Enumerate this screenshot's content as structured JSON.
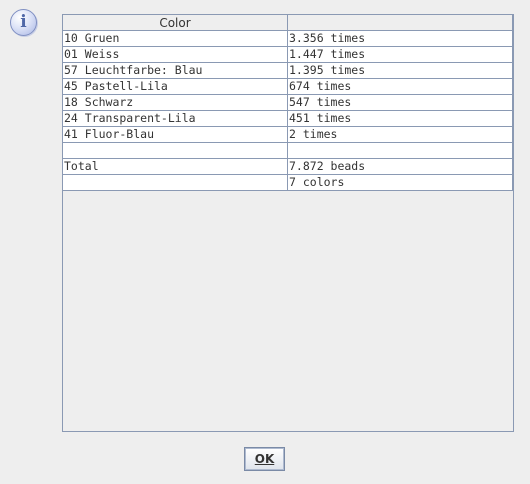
{
  "dialog": {
    "icon": "info-icon",
    "icon_glyph": "i",
    "table": {
      "columns": [
        "Color",
        ""
      ],
      "rows": [
        [
          "10 Gruen",
          "3.356 times"
        ],
        [
          "01 Weiss",
          "1.447 times"
        ],
        [
          "57 Leuchtfarbe: Blau",
          "1.395 times"
        ],
        [
          "45 Pastell-Lila",
          "674 times"
        ],
        [
          "18 Schwarz",
          "547 times"
        ],
        [
          "24 Transparent-Lila",
          "451 times"
        ],
        [
          "41 Fluor-Blau",
          "2 times"
        ],
        [
          "",
          ""
        ],
        [
          "Total",
          "7.872 beads"
        ],
        [
          "",
          "7 colors"
        ]
      ]
    },
    "ok_label": "OK"
  }
}
